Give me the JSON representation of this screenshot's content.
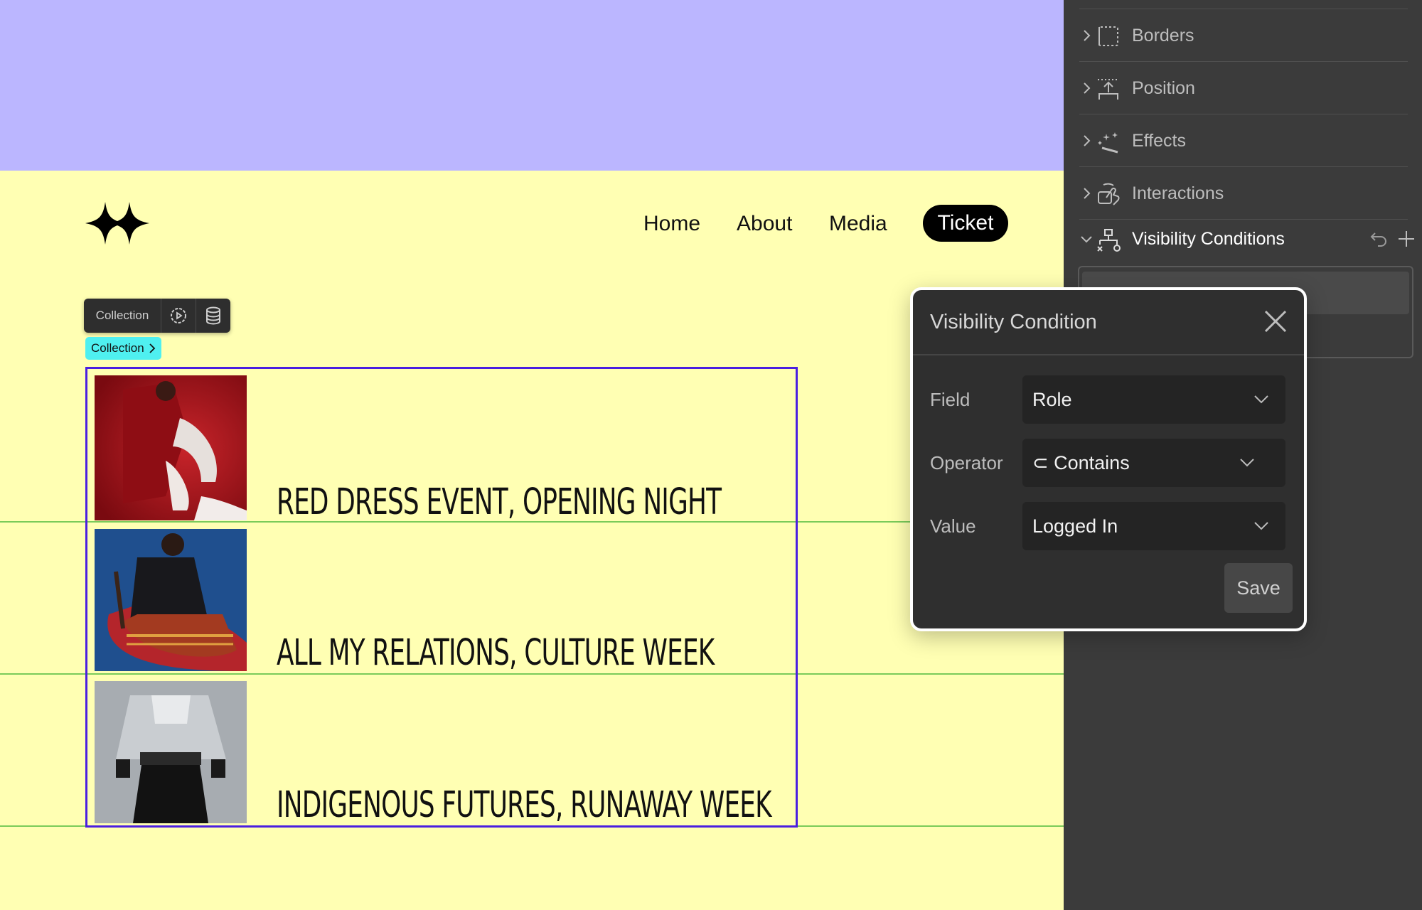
{
  "nav": {
    "home": "Home",
    "about": "About",
    "media": "Media",
    "ticket": "Ticket"
  },
  "collection": {
    "toolbar_label": "Collection",
    "tag_label": "Collection"
  },
  "items": [
    {
      "title": "RED DRESS EVENT, OPENING NIGHT"
    },
    {
      "title": "ALL MY RELATIONS, CULTURE WEEK"
    },
    {
      "title": "INDIGENOUS FUTURES, RUNAWAY WEEK"
    }
  ],
  "panel": {
    "sections": [
      {
        "label": "Borders",
        "icon": "borders-icon"
      },
      {
        "label": "Position",
        "icon": "position-icon"
      },
      {
        "label": "Effects",
        "icon": "effects-icon"
      },
      {
        "label": "Interactions",
        "icon": "interactions-icon"
      },
      {
        "label": "Visibility Conditions",
        "icon": "visibility-conditions-icon"
      }
    ]
  },
  "modal": {
    "title": "Visibility Condition",
    "field_label": "Field",
    "field_value": "Role",
    "operator_label": "Operator",
    "operator_value": "⊂ Contains",
    "value_label": "Value",
    "value_value": "Logged In",
    "save_label": "Save"
  },
  "colors": {
    "top_band": "#bbb6ff",
    "canvas_bg": "#ffffb3",
    "selection": "#4a1fe0",
    "guide": "#7acb5a",
    "panel_bg": "#3b3b3b",
    "tag_bg": "#4ff0f0"
  }
}
